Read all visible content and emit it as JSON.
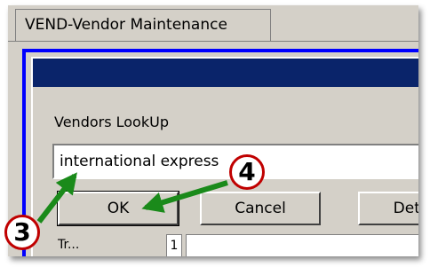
{
  "window_tab": {
    "title": "VEND-Vendor Maintenance"
  },
  "dialog": {
    "label": "Vendors LookUp",
    "input_value": "international express",
    "buttons": {
      "ok": "OK",
      "cancel": "Cancel",
      "details": "Deta"
    }
  },
  "bottom": {
    "label": "Tr...",
    "box_value": "1"
  },
  "annotations": {
    "step_3": "3",
    "step_4": "4"
  },
  "colors": {
    "dialog_title_bar": "#0a246a",
    "outer_border": "#0000ff",
    "arrow": "#1a8a1a",
    "callout_ring": "#c00000"
  }
}
